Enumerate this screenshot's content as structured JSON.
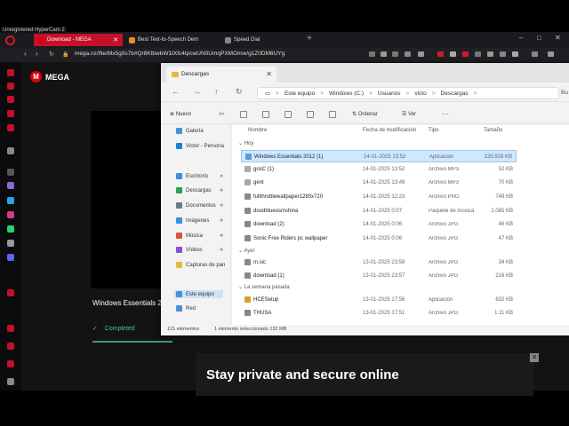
{
  "watermark": "Unregistered HyperCam 2",
  "browser": {
    "tabs": [
      {
        "label": "Download - MEGA",
        "active": true,
        "color": "#d90007"
      },
      {
        "label": "Best Text-to-Speech Dem",
        "active": false,
        "color": "#f08a24"
      },
      {
        "label": "Speed Dial",
        "active": false,
        "color": "#888888"
      }
    ],
    "new_tab": "+",
    "url": "mega.nz/file/Mx5g0s7b#Qr8KtbwbW1tXfc4tpcwUN0UmqPXMOmw/g1Z0DM6UYg",
    "win_min": "–",
    "win_max": "□",
    "win_close": "✕"
  },
  "mega": {
    "logo_letter": "M",
    "logo_text": "MEGA",
    "file_name": "Windows Essentials 2",
    "status": "Completed",
    "check": "✓",
    "banner": "Stay private and secure online",
    "banner_close": "✕"
  },
  "explorer": {
    "tab_title": "Descargas",
    "tab_close": "✕",
    "nav": {
      "back": "←",
      "forward": "→",
      "up": "↑",
      "refresh": "↻"
    },
    "breadcrumbs": [
      "Este equipo",
      "Windows (C:)",
      "Usuarios",
      "victo",
      "Descargas"
    ],
    "breadcrumb_sep": ">",
    "more_crumb": "Bu",
    "commands": {
      "new": "Nuevo",
      "sort": "Ordenar",
      "view": "Ver",
      "more": "···"
    },
    "sidebar": [
      {
        "label": "Galería",
        "pinned": false,
        "color": "#4a8fdb"
      },
      {
        "label": "Victor - Persona",
        "pinned": false,
        "color": "#1f7fd6"
      },
      {
        "label": "Escritorio",
        "pinned": true,
        "color": "#3b8ee0"
      },
      {
        "label": "Descargas",
        "pinned": true,
        "color": "#2e9d5a"
      },
      {
        "label": "Documentos",
        "pinned": true,
        "color": "#6c7a89"
      },
      {
        "label": "Imágenes",
        "pinned": true,
        "color": "#3d8fd8"
      },
      {
        "label": "Música",
        "pinned": true,
        "color": "#e0533d"
      },
      {
        "label": "Vídeos",
        "pinned": true,
        "color": "#8a4fd1"
      },
      {
        "label": "Capturas de pan",
        "pinned": false,
        "color": "#e8b83a"
      },
      {
        "label": "Este equipo",
        "pinned": false,
        "color": "#4a8fdb"
      },
      {
        "label": "Red",
        "pinned": false,
        "color": "#4a8fdb"
      }
    ],
    "pin": "📌",
    "columns": {
      "name": "Nombre",
      "date": "Fecha de modificación",
      "type": "Tipo",
      "size": "Tamaño"
    },
    "groups": [
      {
        "label": "Hoy",
        "files": [
          {
            "name": "Windows Essentials 2012 (1)",
            "date": "14-01-2025 13:52",
            "type": "Aplicación",
            "size": "135.928 KB",
            "selected": true,
            "color": "#5b9bd5"
          },
          {
            "name": "gosC (1)",
            "date": "14-01-2025 13:52",
            "type": "Archivo MP3",
            "size": "52 KB",
            "selected": false,
            "color": "#aaaaaa"
          },
          {
            "name": "gent",
            "date": "14-01-2025 13:49",
            "type": "Archivo MP3",
            "size": "70 KB",
            "selected": false,
            "color": "#aaaaaa"
          },
          {
            "name": "fullthrottlewallpaper1280x720",
            "date": "14-01-2025 12:23",
            "type": "Archivo PNG",
            "size": "749 KB",
            "selected": false,
            "color": "#888888"
          },
          {
            "name": "doodblueosmshina",
            "date": "14-01-2025 0:07",
            "type": "Paquete de música",
            "size": "1.085 KB",
            "selected": false,
            "color": "#888888"
          },
          {
            "name": "download (2)",
            "date": "14-01-2025 0:06",
            "type": "Archivo JPG",
            "size": "46 KB",
            "selected": false,
            "color": "#888888"
          },
          {
            "name": "Sonic Free Riders pc wallpaper",
            "date": "14-01-2025 0:06",
            "type": "Archivo JPG",
            "size": "47 KB",
            "selected": false,
            "color": "#888888"
          }
        ]
      },
      {
        "label": "Ayer",
        "files": [
          {
            "name": "m.sic",
            "date": "13-01-2025 23:58",
            "type": "Archivo JPG",
            "size": "34 KB",
            "selected": false,
            "color": "#888888"
          },
          {
            "name": "download (1)",
            "date": "13-01-2025 23:57",
            "type": "Archivo JPG",
            "size": "216 KB",
            "selected": false,
            "color": "#888888"
          }
        ]
      },
      {
        "label": "La semana pasada",
        "files": [
          {
            "name": "HCESetup",
            "date": "13-01-2025 17:56",
            "type": "Aplicación",
            "size": "632 KB",
            "selected": false,
            "color": "#d8a020"
          },
          {
            "name": "THUSA",
            "date": "13-01-2025 17:51",
            "type": "Archivo JPG",
            "size": "1.11 KB",
            "selected": false,
            "color": "#888888"
          }
        ]
      }
    ],
    "status": {
      "count": "121 elementos",
      "selection": "1 elemento seleccionado 132 MB"
    }
  }
}
